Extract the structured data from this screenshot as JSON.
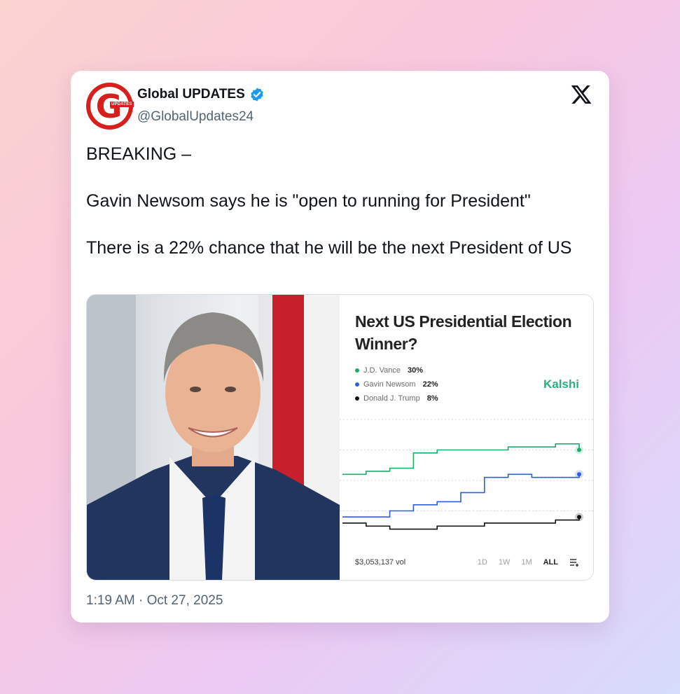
{
  "tweet": {
    "display_name": "Global UPDATES",
    "handle": "@GlobalUpdates24",
    "avatar_letter": "G",
    "avatar_tag": "UPDATES",
    "lines": [
      "BREAKING –",
      "Gavin Newsom says he is \"open to running for President\"",
      "There is a 22% chance that he will be the next President of US"
    ],
    "timestamp": "1:19 AM · Oct 27, 2025",
    "icons": {
      "verified": "verified-badge-icon",
      "platform": "x-logo-icon"
    }
  },
  "market": {
    "title": "Next US Presidential Election Winner?",
    "brand": "Kalshi",
    "volume": "$3,053,137 vol",
    "ranges": [
      "1D",
      "1W",
      "1M",
      "ALL"
    ],
    "active_range": "ALL",
    "candidates": [
      {
        "name": "J.D. Vance",
        "pct": "30%",
        "color": "#22a96e"
      },
      {
        "name": "Gavin Newsom",
        "pct": "22%",
        "color": "#2f5fe0"
      },
      {
        "name": "Donald J. Trump",
        "pct": "8%",
        "color": "#111111"
      }
    ]
  },
  "chart_data": {
    "type": "line",
    "title": "Next US Presidential Election Winner?",
    "x": [
      0,
      10,
      20,
      30,
      40,
      50,
      60,
      70,
      80,
      90,
      100
    ],
    "series": [
      {
        "name": "J.D. Vance",
        "values": [
          22,
          23,
          24,
          29,
          30,
          30,
          30,
          31,
          31,
          32,
          30
        ]
      },
      {
        "name": "Gavin Newsom",
        "values": [
          8,
          8,
          10,
          12,
          13,
          16,
          21,
          22,
          21,
          21,
          22
        ]
      },
      {
        "name": "Donald J. Trump",
        "values": [
          6,
          5,
          4,
          4,
          5,
          5,
          6,
          6,
          6,
          7,
          8
        ]
      }
    ],
    "ylim": [
      0,
      40
    ],
    "grid": true,
    "legend": "top-left"
  },
  "colors": {
    "brand": "#26b07c",
    "verified": "#1d9bf0",
    "avatar": "#d91e1e"
  }
}
